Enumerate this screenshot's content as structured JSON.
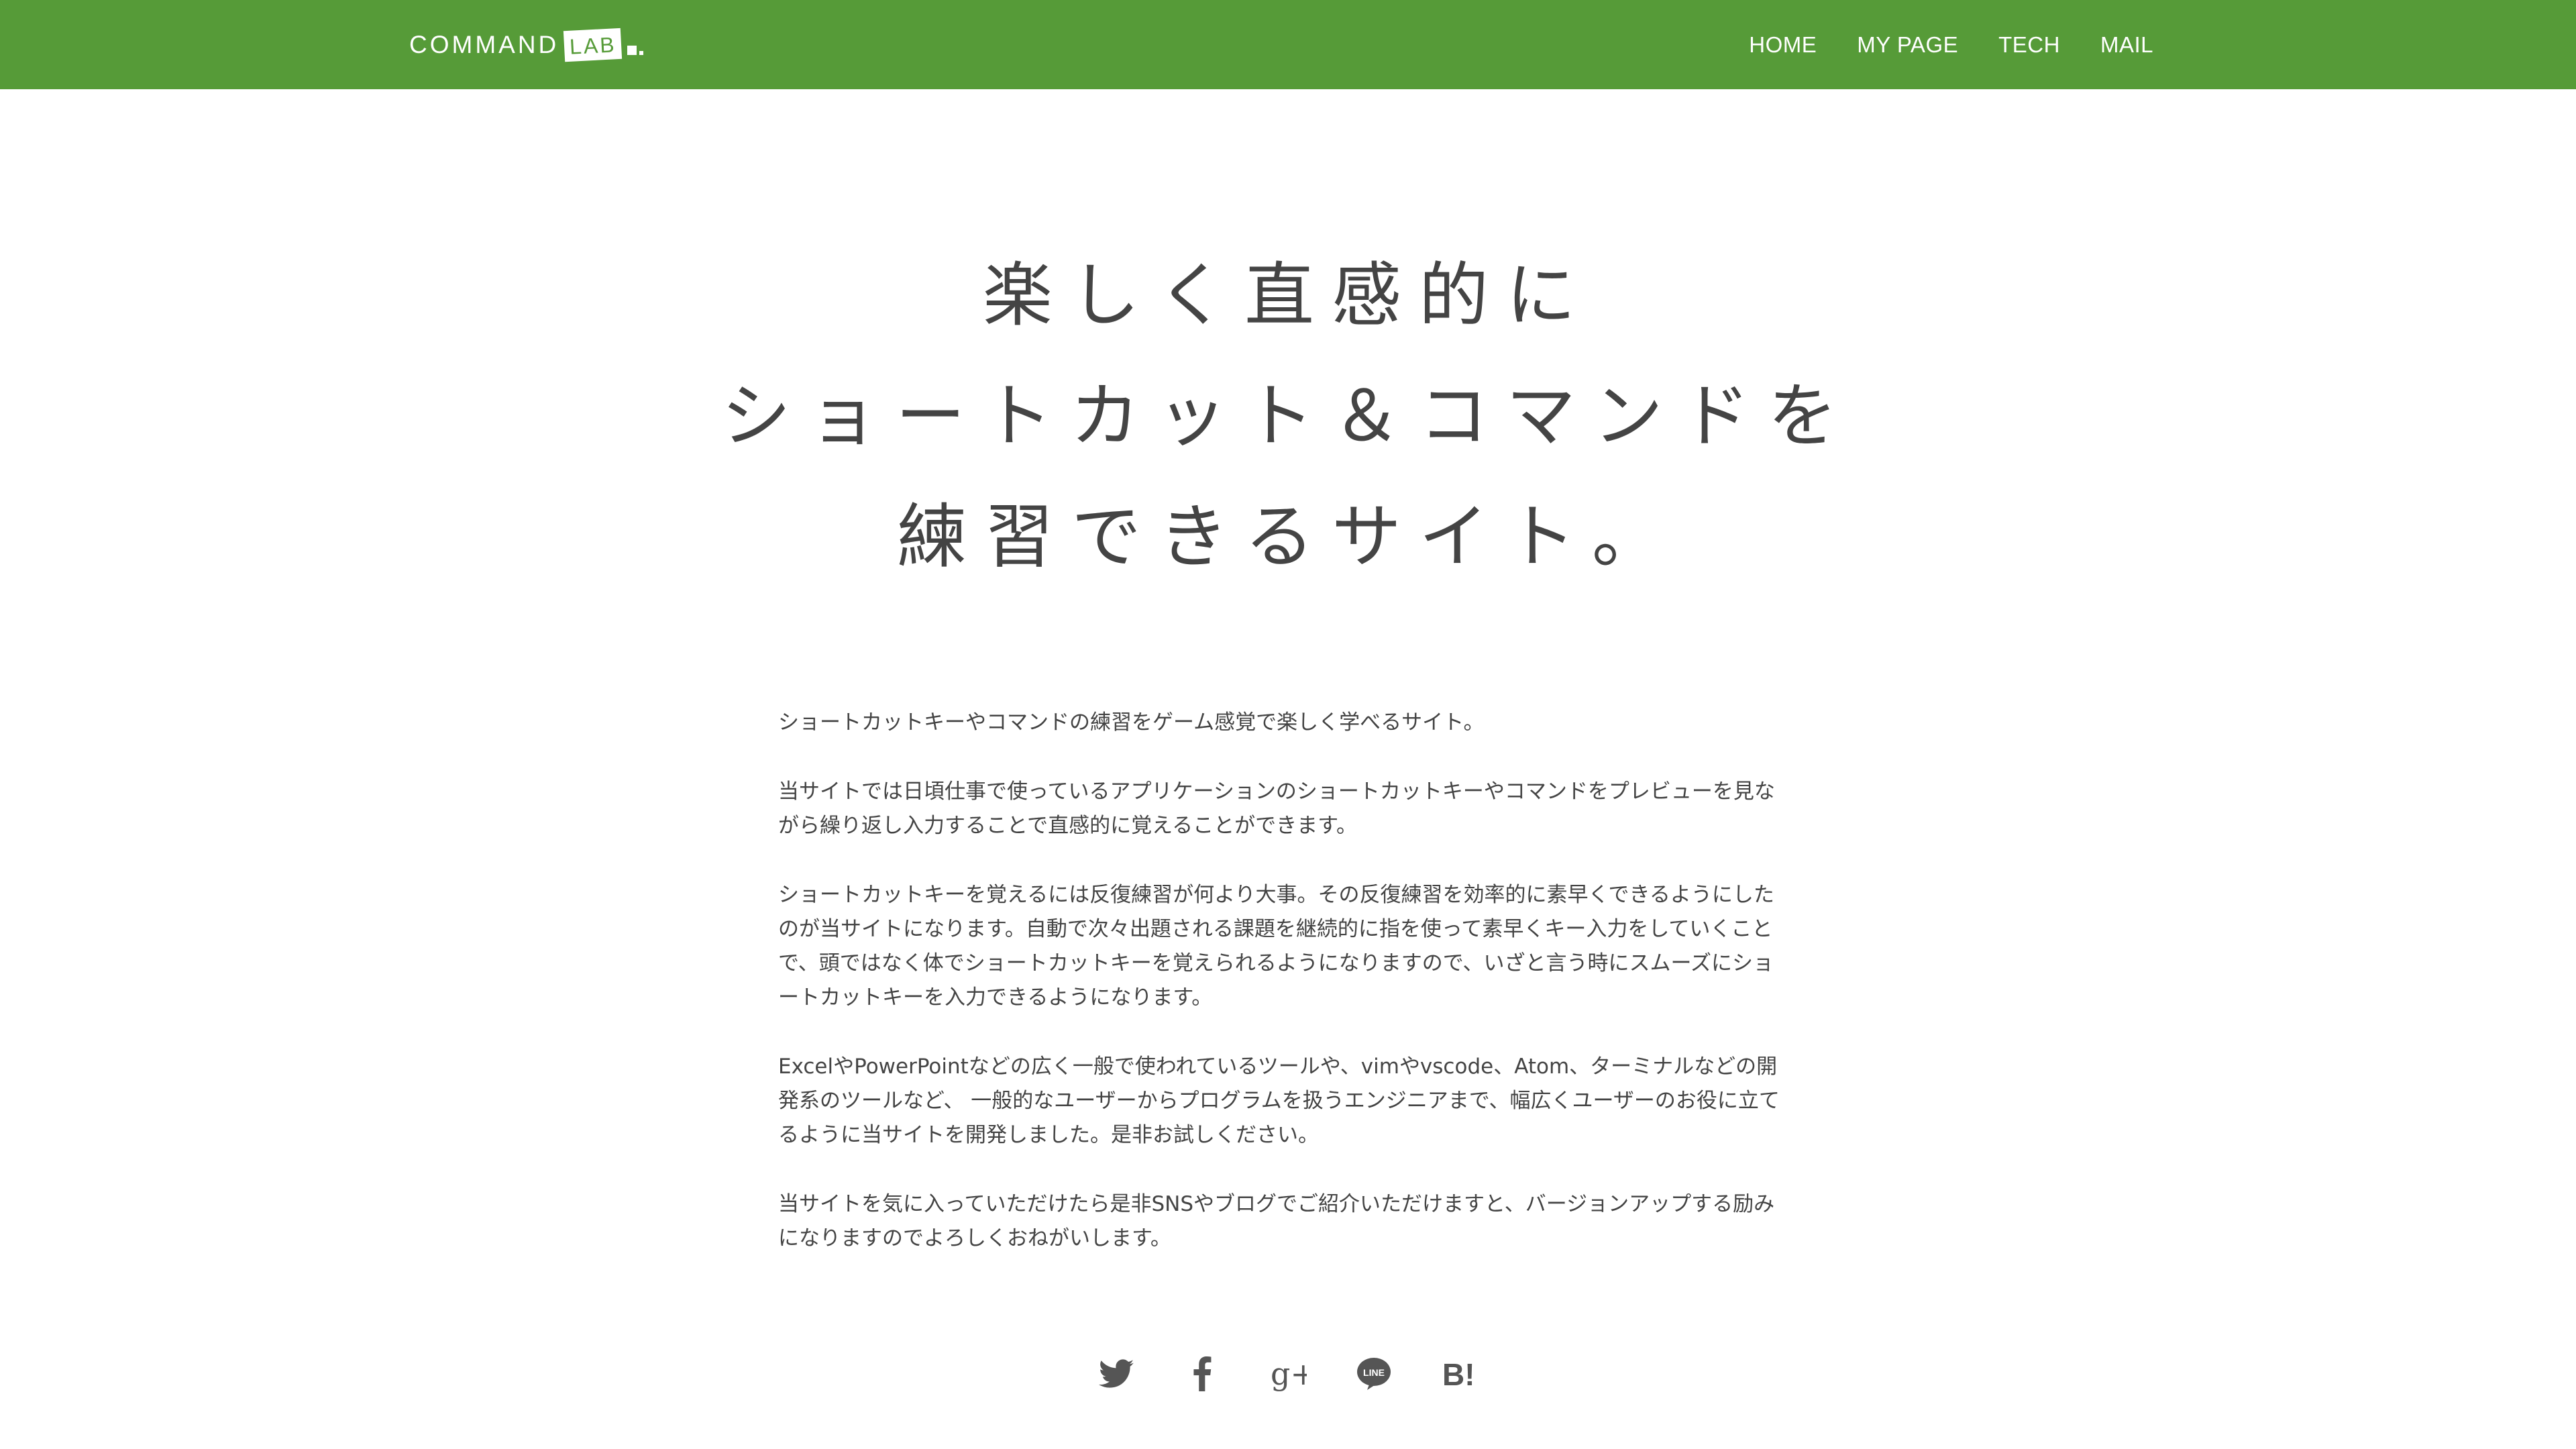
{
  "header": {
    "logo_text": "COMMAND",
    "logo_badge": "LAB",
    "nav": [
      {
        "label": "HOME"
      },
      {
        "label": "MY PAGE"
      },
      {
        "label": "TECH"
      },
      {
        "label": "MAIL"
      }
    ],
    "bg_color": "#569b38"
  },
  "hero": {
    "lines": [
      "楽しく直感的に",
      "ショートカット＆コマンドを",
      "練習できるサイト。"
    ]
  },
  "content": {
    "paragraphs": [
      "ショートカットキーやコマンドの練習をゲーム感覚で楽しく学べるサイト。",
      "当サイトでは日頃仕事で使っているアプリケーションのショートカットキーやコマンドをプレビューを見ながら繰り返し入力することで直感的に覚えることができます。",
      "ショートカットキーを覚えるには反復練習が何より大事。その反復練習を効率的に素早くできるようにしたのが当サイトになります。自動で次々出題される課題を継続的に指を使って素早くキー入力をしていくことで、頭ではなく体でショートカットキーを覚えられるようになりますので、いざと言う時にスムーズにショートカットキーを入力できるようになります。",
      "ExcelやPowerPointなどの広く一般で使われているツールや、vimやvscode、Atom、ターミナルなどの開発系のツールなど、 一般的なユーザーからプログラムを扱うエンジニアまで、幅広くユーザーのお役に立てるように当サイトを開発しました。是非お試しください。",
      "当サイトを気に入っていただけたら是非SNSやブログでご紹介いただけますと、バージョンアップする励みになりますのでよろしくおねがいします。"
    ]
  },
  "share": {
    "icons": [
      "twitter-icon",
      "facebook-icon",
      "google-plus-icon",
      "line-icon",
      "hatena-bookmark-icon"
    ],
    "line_badge": "LINE",
    "hatena_label": "B!",
    "gplus_label": "g+",
    "icon_color": "#555555"
  }
}
